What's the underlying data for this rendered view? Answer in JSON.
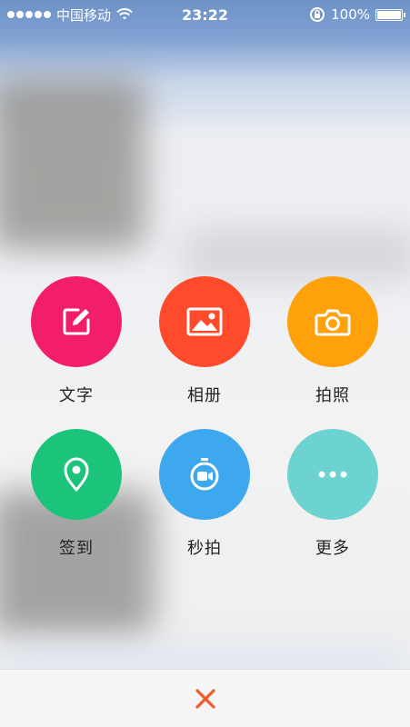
{
  "statusbar": {
    "carrier": "中国移动",
    "time": "23:22",
    "battery": "100%"
  },
  "actions": [
    {
      "label": "文字",
      "icon": "edit-icon",
      "color": "#F21E6A"
    },
    {
      "label": "相册",
      "icon": "photo-album-icon",
      "color": "#FF4B2B"
    },
    {
      "label": "拍照",
      "icon": "camera-icon",
      "color": "#FFA10A"
    },
    {
      "label": "签到",
      "icon": "location-pin-icon",
      "color": "#1BC47A"
    },
    {
      "label": "秒拍",
      "icon": "video-timer-icon",
      "color": "#3DA8EE"
    },
    {
      "label": "更多",
      "icon": "more-icon",
      "color": "#6CD3D1"
    }
  ],
  "bottom": {
    "close_icon": "close-icon",
    "close_color": "#F25A2A"
  }
}
